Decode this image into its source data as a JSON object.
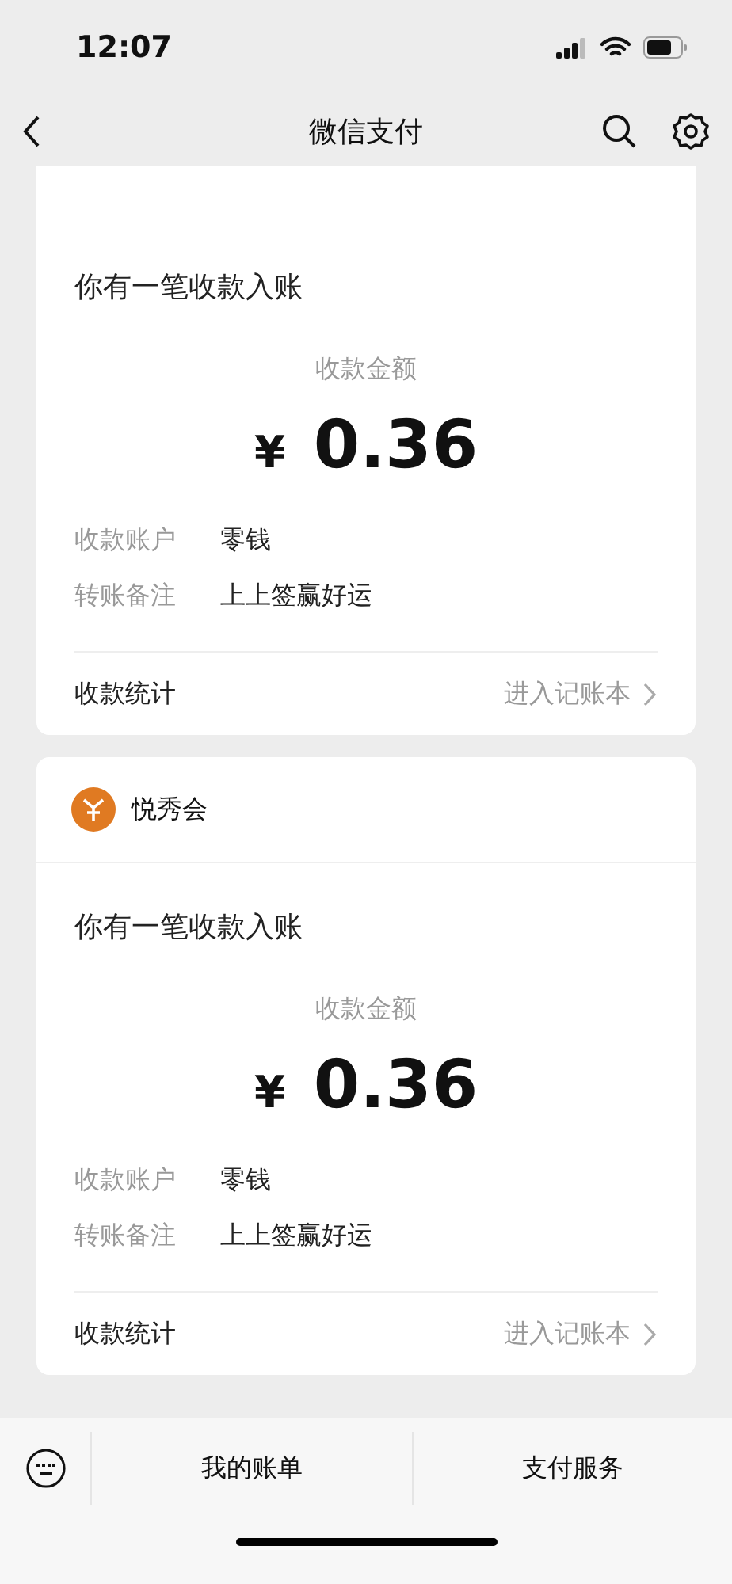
{
  "status_bar": {
    "time": "12:07"
  },
  "nav": {
    "title": "微信支付"
  },
  "messages": [
    {
      "title": "你有一笔收款入账",
      "amount_label": "收款金额",
      "currency": "¥",
      "amount": "0.36",
      "fields": [
        {
          "label": "收款账户",
          "value": "零钱"
        },
        {
          "label": "转账备注",
          "value": "上上签赢好运"
        }
      ],
      "footer_label": "收款统计",
      "footer_link": "进入记账本"
    },
    {
      "merchant": "悦秀会",
      "title": "你有一笔收款入账",
      "amount_label": "收款金额",
      "currency": "¥",
      "amount": "0.36",
      "fields": [
        {
          "label": "收款账户",
          "value": "零钱"
        },
        {
          "label": "转账备注",
          "value": "上上签赢好运"
        }
      ],
      "footer_label": "收款统计",
      "footer_link": "进入记账本"
    }
  ],
  "bottom_bar": {
    "items": [
      {
        "label": "我的账单"
      },
      {
        "label": "支付服务"
      }
    ]
  }
}
